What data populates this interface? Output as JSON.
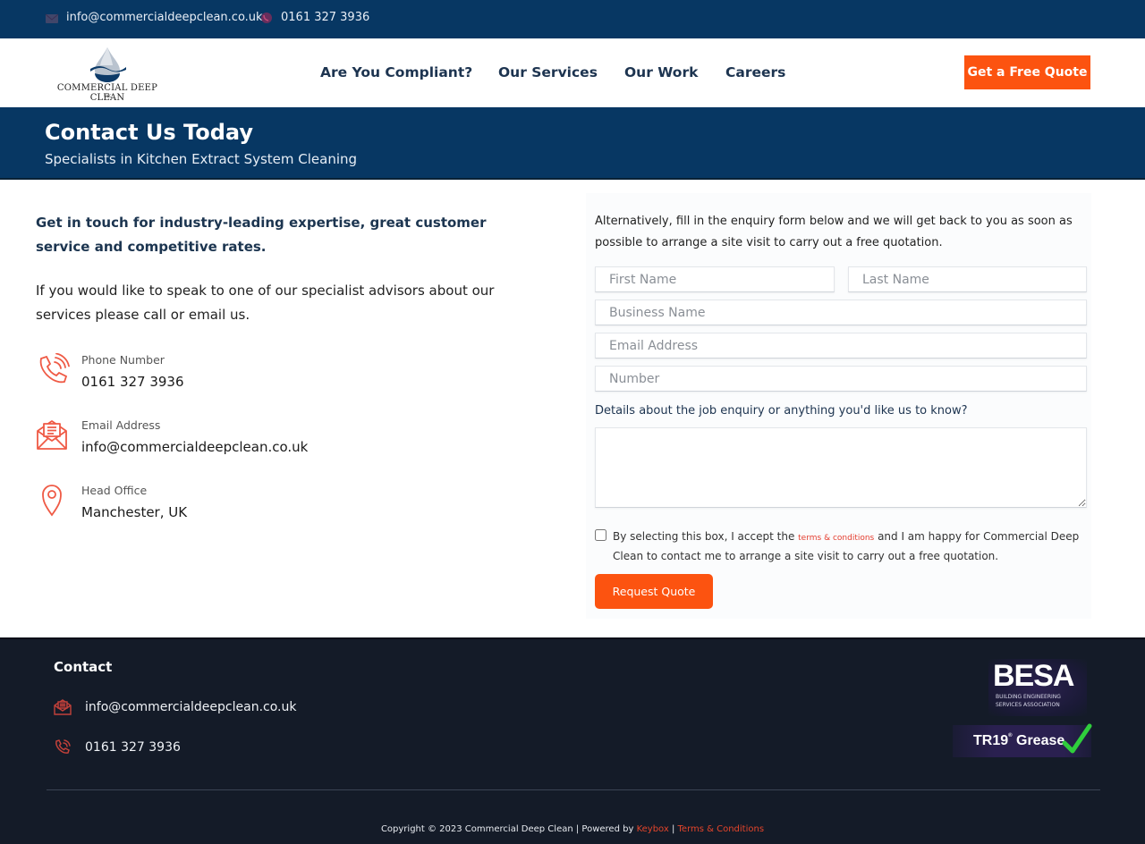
{
  "topbar": {
    "email": "info@commercialdeepclean.co.uk",
    "phone": "0161 327 3936"
  },
  "header": {
    "logo_text": "Commercial Deep Clean",
    "logo_sub": "UK",
    "nav": [
      "Are You Compliant?",
      "Our Services",
      "Our Work",
      "Careers"
    ],
    "cta_label": "Get a Free Quote"
  },
  "banner": {
    "title": "Contact Us Today",
    "subtitle": "Specialists in Kitchen Extract System Cleaning"
  },
  "left": {
    "intro_bold": "Get in touch for industry-leading expertise, great customer service and competitive rates.",
    "intro": "If you would like to speak to one of our specialist advisors about our services please call or email us.",
    "contacts": [
      {
        "icon": "phone-icon",
        "label": "Phone Number",
        "value": "0161 327 3936"
      },
      {
        "icon": "envelope-icon",
        "label": "Email Address",
        "value": "info@commercialdeepclean.co.uk"
      },
      {
        "icon": "location-pin-icon",
        "label": "Head Office",
        "value": "Manchester, UK"
      }
    ]
  },
  "form": {
    "intro": "Alternatively, fill in the enquiry form below and we will get back to you as soon as possible to arrange a site visit to carry out a free quotation.",
    "first_name_placeholder": "First Name",
    "last_name_placeholder": "Last Name",
    "business_placeholder": "Business Name",
    "email_placeholder": "Email Address",
    "number_placeholder": "Number",
    "details_label": "Details about the job enquiry or anything you'd like us to know?",
    "details_value": "",
    "consent_before": "By selecting this box, I accept the ",
    "consent_link": "terms & conditions",
    "consent_after": " and I am happy for Commercial Deep Clean to contact me to arrange a site visit to carry out a free quotation.",
    "consent_checked": false,
    "submit_label": "Request Quote"
  },
  "footer": {
    "heading": "Contact",
    "email": "info@commercialdeepclean.co.uk",
    "phone": "0161 327 3936",
    "besa_title": "BESA",
    "besa_subtitle": "BUILDING ENGINEERING SERVICES ASSOCIATION",
    "tr19_label": "TR19",
    "tr19_mark": "®",
    "tr19_suffix": " Grease",
    "copyright": "Copyright © 2023 Commercial Deep Clean | Powered by ",
    "powered_link": "Keybox",
    "separator": " | ",
    "terms_link": "Terms & Conditions"
  },
  "colors": {
    "navy": "#073763",
    "accent": "#fc5310",
    "footer_bg": "#141b28",
    "link_red": "#e43d2f"
  }
}
